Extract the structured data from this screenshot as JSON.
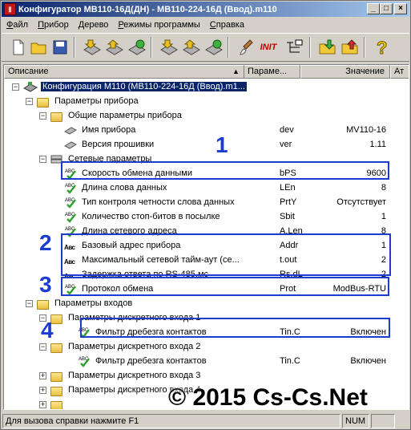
{
  "window": {
    "title": "Конфигуратор МВ110-16Д(ДН) - МВ110-224-16Д (Ввод).m110",
    "app_icon": "Ⅱ"
  },
  "titlebar_buttons": {
    "minimize": "_",
    "maximize": "□",
    "close": "×"
  },
  "menu": [
    "Файл",
    "Прибор",
    "Дерево",
    "Режимы программы",
    "Справка"
  ],
  "menu_mnemonic": [
    "Ф",
    "П",
    "Д",
    "Р",
    "С"
  ],
  "toolbar": {
    "init_label": "INIT"
  },
  "columns": {
    "desc": "Описание",
    "param": "Параме...",
    "value": "Значение",
    "extra": "Ат"
  },
  "rows": [
    {
      "label": "Конфигурация М110 (МВ110-224-16Д (Ввод).m1...",
      "param": "",
      "value": ""
    },
    {
      "label": "Параметры прибора",
      "param": "",
      "value": ""
    },
    {
      "label": "Общие параметры прибора",
      "param": "",
      "value": ""
    },
    {
      "label": "Имя прибора",
      "param": "dev",
      "value": "MV110-16"
    },
    {
      "label": "Версия прошивки",
      "param": "ver",
      "value": "1.11"
    },
    {
      "label": "Сетевые параметры",
      "param": "",
      "value": ""
    },
    {
      "label": "Скорость обмена данными",
      "param": "bPS",
      "value": "9600"
    },
    {
      "label": "Длина слова данных",
      "param": "LEn",
      "value": "8"
    },
    {
      "label": "Тип контроля четности слова данных",
      "param": "PrtY",
      "value": "Отсутствует"
    },
    {
      "label": "Количество стоп-битов в посылке",
      "param": "Sbit",
      "value": "1"
    },
    {
      "label": "Длина сетевого адреса",
      "param": "A.Len",
      "value": "8"
    },
    {
      "label": "Базовый адрес прибора",
      "param": "Addr",
      "value": "1"
    },
    {
      "label": "Максимальный сетевой тайм-аут (се...",
      "param": "t.out",
      "value": "2"
    },
    {
      "label": "Задержка ответа по RS-485,мс",
      "param": "Rs.dL",
      "value": "2"
    },
    {
      "label": "Протокол обмена",
      "param": "Prot",
      "value": "ModBus-RTU"
    },
    {
      "label": "Параметры входов",
      "param": "",
      "value": ""
    },
    {
      "label": "Параметры дискретного входа 1",
      "param": "",
      "value": ""
    },
    {
      "label": "Фильтр дребезга контактов",
      "param": "Tin.C",
      "value": "Включен"
    },
    {
      "label": "Параметры дискретного входа 2",
      "param": "",
      "value": ""
    },
    {
      "label": "Фильтр дребезга контактов",
      "param": "Tin.C",
      "value": "Включен"
    },
    {
      "label": "Параметры дискретного входа 3",
      "param": "",
      "value": ""
    },
    {
      "label": "Параметры дискретного входа 4",
      "param": "",
      "value": ""
    },
    {
      "label": "",
      "param": "",
      "value": ""
    }
  ],
  "icon_text": {
    "abc": "ABC",
    "abc_small": "Авс"
  },
  "annotations": [
    "1",
    "2",
    "3",
    "4"
  ],
  "watermark": "© 2015 Cs-Cs.Net",
  "status": {
    "help": "Для вызова справки нажмите F1",
    "num": "NUM"
  }
}
